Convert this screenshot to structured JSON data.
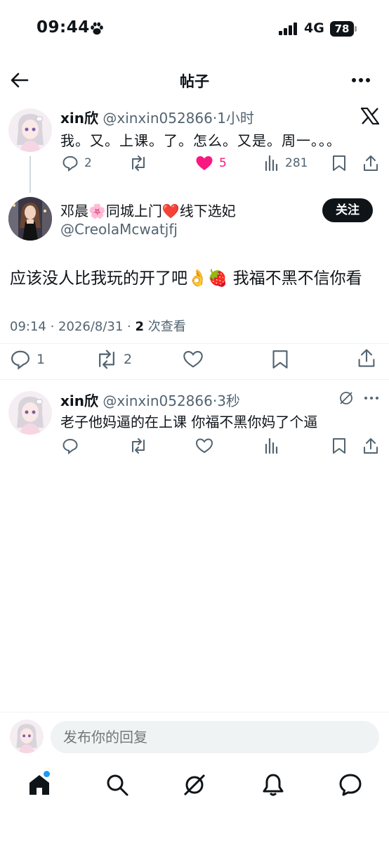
{
  "status_bar": {
    "time": "09:44",
    "network": "4G",
    "battery": "78"
  },
  "header": {
    "title": "帖子"
  },
  "parent_post": {
    "name": "xin欣",
    "handle": "@xinxin052866",
    "time": "·1小时",
    "text": "我。又。上课。了。怎么。又是。周一。。。",
    "replies": "2",
    "likes": "5",
    "views": "281",
    "liked_color": "#f91880"
  },
  "main_post": {
    "name": "邓晨🌸同城上门❤️线下选妃",
    "handle": "@CreolaMcwatjfj",
    "follow_label": "关注",
    "text": "应该没人比我玩的开了吧👌🍓 我福不黑不信你看",
    "timestamp": "09:14 · 2026/8/31 · ",
    "views_count": "2",
    "views_label": " 次查看",
    "replies": "1",
    "reposts": "2"
  },
  "reply": {
    "name": "xin欣",
    "handle": "@xinxin052866",
    "time": "·3秒",
    "text": "老子他妈逼的在上课 你福不黑你妈了个逼"
  },
  "composer": {
    "placeholder": "发布你的回复"
  },
  "tabs": [
    "home",
    "search",
    "grok",
    "notifications",
    "messages"
  ],
  "accent_color": "#1d9bf0"
}
